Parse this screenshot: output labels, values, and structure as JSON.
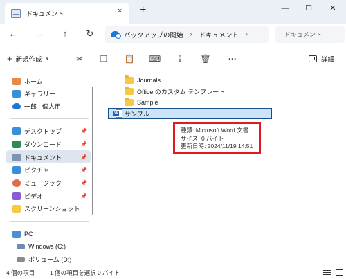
{
  "window": {
    "tab_title": "ドキュメント",
    "tab_close": "×",
    "new_tab": "+",
    "minimize": "—",
    "maximize": "☐",
    "close": "✕"
  },
  "nav": {
    "back": "←",
    "forward": "→",
    "up": "↑",
    "refresh": "↻",
    "breadcrumb": [
      "バックアップの開始",
      "ドキュメント"
    ],
    "separator": "›",
    "search_placeholder": "ドキュメント"
  },
  "toolbar": {
    "new_label": "新規作成",
    "details_label": "詳細",
    "more": "···",
    "icons": [
      "cut-icon",
      "copy-icon",
      "paste-icon",
      "rename-icon",
      "share-icon",
      "delete-icon"
    ]
  },
  "sidebar": {
    "quick": [
      {
        "label": "ホーム",
        "icon": "home-icon",
        "color": "#e8884a"
      },
      {
        "label": "ギャラリー",
        "icon": "gallery-icon",
        "color": "#3b8fd9"
      },
      {
        "label": "一郎 - 個人用",
        "icon": "onedrive-icon",
        "color": "#1d77d6"
      }
    ],
    "pinned": [
      {
        "label": "デスクトップ",
        "icon": "desktop-icon",
        "color": "#3b8fd9"
      },
      {
        "label": "ダウンロード",
        "icon": "download-icon",
        "color": "#2e8b57"
      },
      {
        "label": "ドキュメント",
        "icon": "documents-icon",
        "color": "#7f93b5"
      },
      {
        "label": "ピクチャ",
        "icon": "pictures-icon",
        "color": "#3b8fd9"
      },
      {
        "label": "ミュージック",
        "icon": "music-icon",
        "color": "#e06b4d"
      },
      {
        "label": "ビデオ",
        "icon": "videos-icon",
        "color": "#8a5cd1"
      },
      {
        "label": "スクリーンショット",
        "icon": "screenshots-folder-icon",
        "color": "#f6c945"
      }
    ],
    "this_pc": "PC",
    "drives": [
      {
        "label": "Windows (C:)",
        "icon": "drive-icon",
        "color": "#6f8bb3"
      },
      {
        "label": "ボリューム (D:)",
        "icon": "drive-icon",
        "color": "#8a8a8a"
      }
    ]
  },
  "files": [
    {
      "name": "Journals",
      "type": "folder"
    },
    {
      "name": "Office のカスタム テンプレート",
      "type": "folder"
    },
    {
      "name": "Sample",
      "type": "folder"
    }
  ],
  "selected_file": {
    "name": "サンプル",
    "icon_letter": "W"
  },
  "tooltip": {
    "line1": "種類: Microsoft Word 文書",
    "line2": "サイズ: 0 バイト",
    "line3": "更新日時: 2024/11/19 14:51"
  },
  "status": {
    "items": "4 個の項目",
    "selected": "1 個の項目を選択  0 バイト"
  }
}
